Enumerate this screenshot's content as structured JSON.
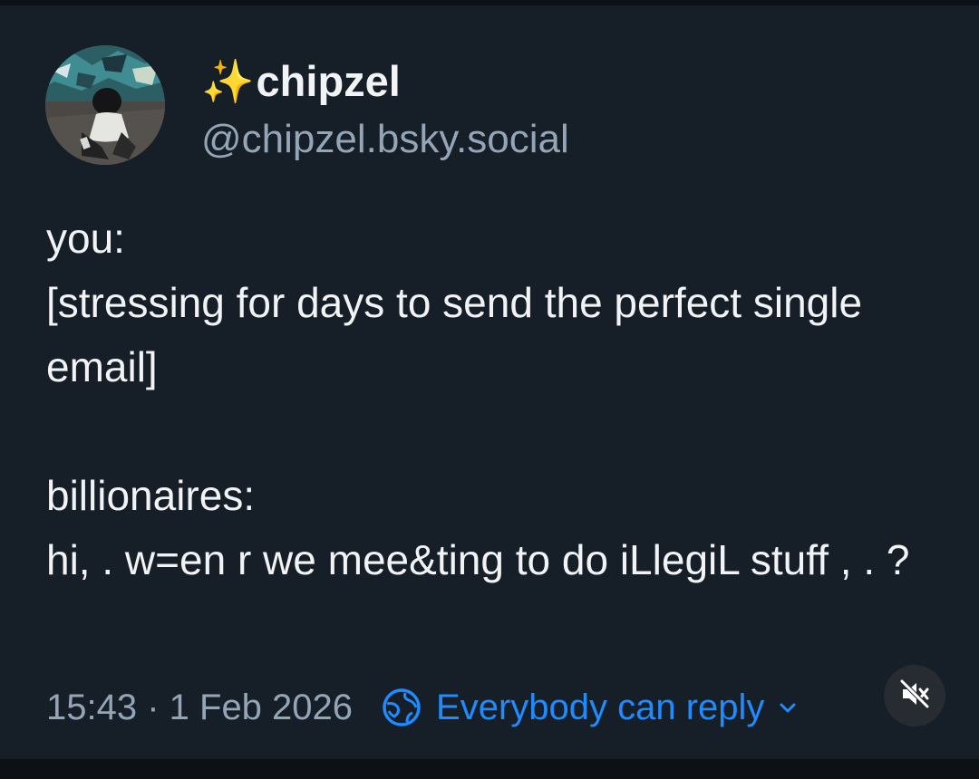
{
  "post": {
    "author": {
      "display_name_emoji": "✨",
      "display_name": "chipzel",
      "handle": "@chipzel.bsky.social",
      "avatar": "avatar-image"
    },
    "text": "you:\n[stressing for days to send the perfect single email]\n\nbillionaires:\nhi, . w=en r we mee&ting to do iLlegiL stuff , . ?",
    "timestamp": "15:43 · 1 Feb 2026",
    "reply_settings": {
      "label": "Everybody can reply",
      "icon": "globe-icon",
      "dropdown_icon": "chevron-down-icon"
    }
  },
  "overlay": {
    "mute_icon": "speaker-muted-icon"
  },
  "colors": {
    "background": "#161e27",
    "text_primary": "#f1f3f5",
    "text_secondary": "#93a5b7",
    "accent": "#208bfe"
  }
}
